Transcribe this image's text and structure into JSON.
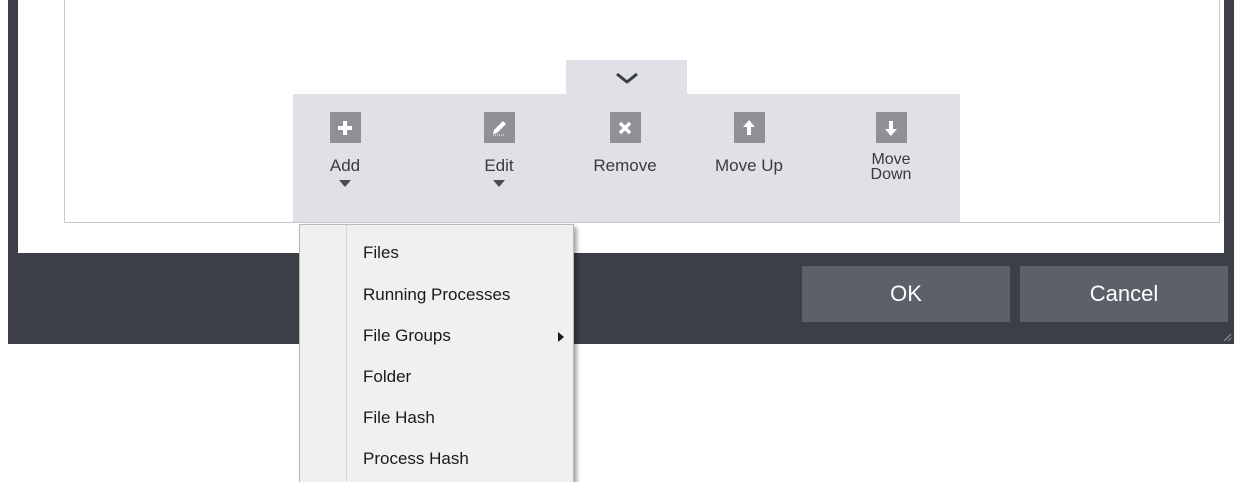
{
  "toolbar": {
    "collapse_icon": "chevron-down-icon",
    "buttons": [
      {
        "label": "Add",
        "icon": "plus-icon",
        "has_menu": true
      },
      {
        "label": "Edit",
        "icon": "pencil-icon",
        "has_menu": true
      },
      {
        "label": "Remove",
        "icon": "x-icon",
        "has_menu": false
      },
      {
        "label": "Move Up",
        "icon": "arrow-up-icon",
        "has_menu": false
      },
      {
        "label_line1": "Move",
        "label_line2": "Down",
        "icon": "arrow-down-icon",
        "has_menu": false
      }
    ]
  },
  "dialog": {
    "ok_label": "OK",
    "cancel_label": "Cancel"
  },
  "add_menu": {
    "items": [
      {
        "label": "Files"
      },
      {
        "label": "Running Processes"
      },
      {
        "label": "File Groups",
        "submenu": true
      },
      {
        "label": "Folder"
      },
      {
        "label": "File Hash"
      },
      {
        "label": "Process Hash"
      }
    ]
  },
  "colors": {
    "dialog_dark": "#3c3f46",
    "toolbar_bg": "#dfe1e7",
    "icon_tile": "#8f9196",
    "button_bg": "#5d6069",
    "menu_bg": "#f0f0f0"
  }
}
